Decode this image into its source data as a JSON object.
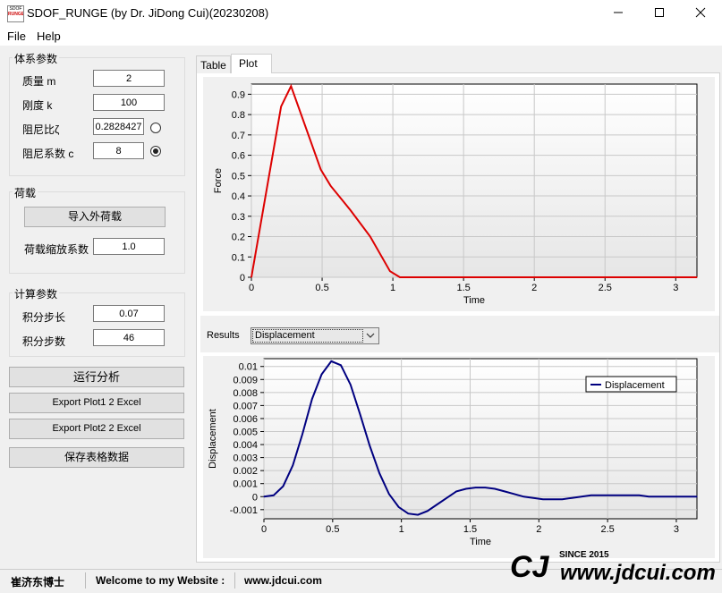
{
  "window": {
    "title": "SDOF_RUNGE (by Dr. JiDong Cui)(20230208)",
    "icon_text_top": "SDOF",
    "icon_text_bottom": "RUNGE",
    "minimize_icon": "minimize-icon",
    "maximize_icon": "maximize-icon",
    "close_icon": "close-icon"
  },
  "menu": {
    "file": "File",
    "help": "Help"
  },
  "params": {
    "group_title": "体系参数",
    "mass_label": "质量 m",
    "mass_value": "2",
    "stiffness_label": "刚度 k",
    "stiffness_value": "100",
    "damping_ratio_label": "阻尼比ζ",
    "damping_ratio_value": "0.2828427",
    "damping_coef_label": "阻尼系数 c",
    "damping_coef_value": "8",
    "selected": "damping_coef"
  },
  "load": {
    "group_title": "荷载",
    "import_button": "导入外荷载",
    "scale_label": "荷载缩放系数",
    "scale_value": "1.0"
  },
  "calc": {
    "group_title": "计算参数",
    "step_label": "积分步长",
    "step_value": "0.07",
    "count_label": "积分步数",
    "count_value": "46"
  },
  "actions": {
    "run": "运行分析",
    "export1": "Export Plot1 2 Excel",
    "export2": "Export Plot2 2 Excel",
    "save": "保存表格数据"
  },
  "tabs": {
    "table": "Table",
    "plot": "Plot",
    "active": "plot"
  },
  "results": {
    "label": "Results",
    "selected": "Displacement"
  },
  "status": {
    "author": "崔济东博士",
    "welcome": "Welcome to my Website :",
    "url": "www.jdcui.com"
  },
  "watermark": {
    "logo": "CJ",
    "since": "SINCE 2015",
    "url": "www.jdcui.com"
  },
  "chart_data": [
    {
      "type": "line",
      "title": "",
      "xlabel": "Time",
      "ylabel": "Force",
      "xlim": [
        0,
        3.15
      ],
      "ylim": [
        0,
        0.95
      ],
      "xticks": [
        "0",
        "0.5",
        "1",
        "1.5",
        "2",
        "2.5",
        "3"
      ],
      "yticks": [
        "0",
        "0.1",
        "0.2",
        "0.3",
        "0.4",
        "0.5",
        "0.6",
        "0.7",
        "0.8",
        "0.9"
      ],
      "grid": true,
      "series": [
        {
          "color": "#dd0000",
          "x": [
            0,
            0.21,
            0.28,
            0.49,
            0.56,
            0.7,
            0.84,
            0.98,
            1.05,
            1.5,
            2.0,
            2.5,
            3.15
          ],
          "y": [
            0,
            0.84,
            0.94,
            0.53,
            0.45,
            0.33,
            0.2,
            0.03,
            0.0,
            0.0,
            0.0,
            0.0,
            0.0
          ]
        }
      ]
    },
    {
      "type": "line",
      "title": "",
      "xlabel": "Time",
      "ylabel": "Displacement",
      "xlim": [
        0,
        3.15
      ],
      "ylim": [
        -0.0017,
        0.0106
      ],
      "xticks": [
        "0",
        "0.5",
        "1",
        "1.5",
        "2",
        "2.5",
        "3"
      ],
      "yticks": [
        "-0.001",
        "0",
        "0.001",
        "0.002",
        "0.003",
        "0.004",
        "0.005",
        "0.006",
        "0.007",
        "0.008",
        "0.009",
        "0.01"
      ],
      "grid": true,
      "legend": "top-right",
      "series": [
        {
          "name": "Displacement",
          "color": "#000080",
          "x": [
            0,
            0.07,
            0.14,
            0.21,
            0.28,
            0.35,
            0.42,
            0.49,
            0.56,
            0.63,
            0.7,
            0.77,
            0.84,
            0.91,
            0.98,
            1.05,
            1.12,
            1.19,
            1.26,
            1.33,
            1.4,
            1.47,
            1.54,
            1.61,
            1.68,
            1.75,
            1.82,
            1.89,
            1.96,
            2.03,
            2.1,
            2.17,
            2.24,
            2.31,
            2.38,
            2.45,
            2.52,
            2.59,
            2.66,
            2.73,
            2.8,
            2.87,
            2.94,
            3.01,
            3.08,
            3.15
          ],
          "y": [
            0,
            0.0001,
            0.0008,
            0.0024,
            0.0048,
            0.0075,
            0.0094,
            0.0104,
            0.0101,
            0.0086,
            0.0063,
            0.0039,
            0.0018,
            0.0002,
            -0.0008,
            -0.0013,
            -0.0014,
            -0.0011,
            -0.0006,
            -0.0001,
            0.0004,
            0.0006,
            0.0007,
            0.0007,
            0.0006,
            0.0004,
            0.0002,
            0.0,
            -0.0001,
            -0.0002,
            -0.0002,
            -0.0002,
            -0.0001,
            0.0,
            0.0001,
            0.0001,
            0.0001,
            0.0001,
            0.0001,
            0.0001,
            0.0,
            0.0,
            0.0,
            0.0,
            0.0,
            0.0
          ]
        }
      ]
    }
  ]
}
